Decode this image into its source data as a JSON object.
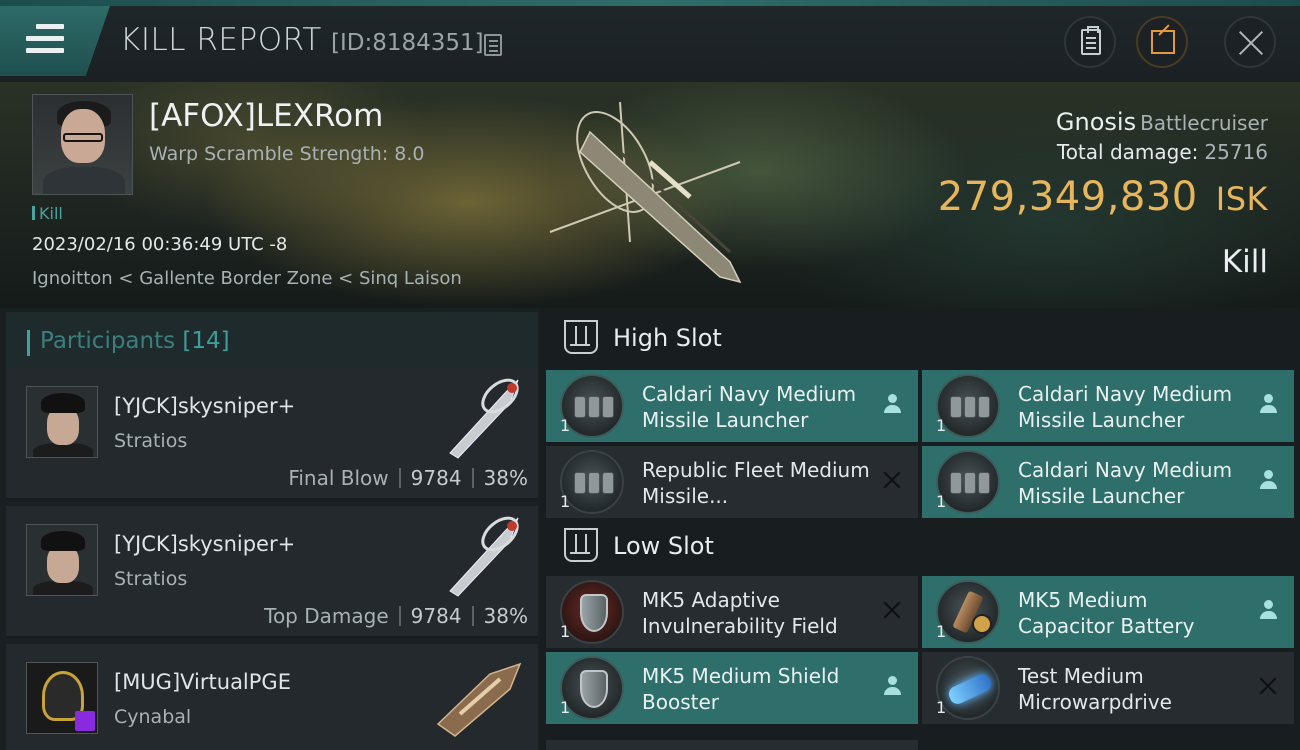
{
  "header": {
    "title": "KILL REPORT",
    "report_id": "[ID:8184351]"
  },
  "victim": {
    "name": "[AFOX]LEXRom",
    "warp_scramble": "Warp Scramble Strength: 8.0",
    "tag": "Kill",
    "datetime": "2023/02/16 00:36:49 UTC -8",
    "location": "Ignoitton < Gallente Border Zone < Sinq Laison",
    "ship_name": "Gnosis",
    "ship_class": "Battlecruiser",
    "total_damage_label": "Total damage:",
    "total_damage": "25716",
    "isk_value": "279,349,830",
    "isk_unit": "ISK",
    "result": "Kill"
  },
  "participants": {
    "title": "Participants",
    "count": "[14]",
    "items": [
      {
        "name": "[YJCK]skysniper+",
        "ship": "Stratios",
        "role": "Final Blow",
        "damage": "9784",
        "percent": "38%"
      },
      {
        "name": "[YJCK]skysniper+",
        "ship": "Stratios",
        "role": "Top Damage",
        "damage": "9784",
        "percent": "38%"
      },
      {
        "name": "[MUG]VirtualPGE",
        "ship": "Cynabal"
      }
    ]
  },
  "fitting": {
    "high_slot_title": "High Slot",
    "low_slot_title": "Low Slot",
    "high_slot": [
      {
        "name": "Caldari Navy Medium Missile Launcher",
        "qty": "1",
        "status": "dropped"
      },
      {
        "name": "Caldari Navy Medium Missile Launcher",
        "qty": "1",
        "status": "dropped"
      },
      {
        "name": "Republic Fleet Medium Missile...",
        "qty": "1",
        "status": "destroyed"
      },
      {
        "name": "Caldari Navy Medium Missile Launcher",
        "qty": "1",
        "status": "dropped"
      }
    ],
    "low_slot": [
      {
        "name": "MK5 Adaptive Invulnerability Field",
        "qty": "1",
        "status": "destroyed"
      },
      {
        "name": "MK5 Medium Capacitor Battery",
        "qty": "1",
        "status": "dropped"
      },
      {
        "name": "MK5 Medium Shield Booster",
        "qty": "1",
        "status": "dropped"
      },
      {
        "name": "Test Medium Microwarpdrive",
        "qty": "1",
        "status": "destroyed"
      }
    ]
  }
}
